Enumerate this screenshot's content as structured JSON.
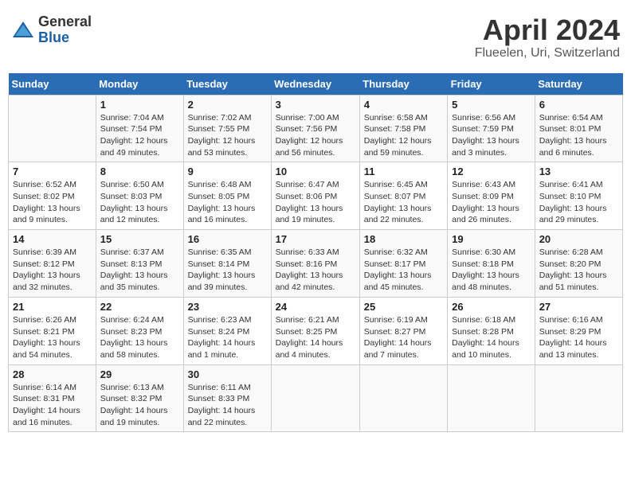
{
  "header": {
    "logo_general": "General",
    "logo_blue": "Blue",
    "month_title": "April 2024",
    "location": "Flueelen, Uri, Switzerland"
  },
  "days_of_week": [
    "Sunday",
    "Monday",
    "Tuesday",
    "Wednesday",
    "Thursday",
    "Friday",
    "Saturday"
  ],
  "weeks": [
    [
      {
        "day": "",
        "info": ""
      },
      {
        "day": "1",
        "info": "Sunrise: 7:04 AM\nSunset: 7:54 PM\nDaylight: 12 hours\nand 49 minutes."
      },
      {
        "day": "2",
        "info": "Sunrise: 7:02 AM\nSunset: 7:55 PM\nDaylight: 12 hours\nand 53 minutes."
      },
      {
        "day": "3",
        "info": "Sunrise: 7:00 AM\nSunset: 7:56 PM\nDaylight: 12 hours\nand 56 minutes."
      },
      {
        "day": "4",
        "info": "Sunrise: 6:58 AM\nSunset: 7:58 PM\nDaylight: 12 hours\nand 59 minutes."
      },
      {
        "day": "5",
        "info": "Sunrise: 6:56 AM\nSunset: 7:59 PM\nDaylight: 13 hours\nand 3 minutes."
      },
      {
        "day": "6",
        "info": "Sunrise: 6:54 AM\nSunset: 8:01 PM\nDaylight: 13 hours\nand 6 minutes."
      }
    ],
    [
      {
        "day": "7",
        "info": "Sunrise: 6:52 AM\nSunset: 8:02 PM\nDaylight: 13 hours\nand 9 minutes."
      },
      {
        "day": "8",
        "info": "Sunrise: 6:50 AM\nSunset: 8:03 PM\nDaylight: 13 hours\nand 12 minutes."
      },
      {
        "day": "9",
        "info": "Sunrise: 6:48 AM\nSunset: 8:05 PM\nDaylight: 13 hours\nand 16 minutes."
      },
      {
        "day": "10",
        "info": "Sunrise: 6:47 AM\nSunset: 8:06 PM\nDaylight: 13 hours\nand 19 minutes."
      },
      {
        "day": "11",
        "info": "Sunrise: 6:45 AM\nSunset: 8:07 PM\nDaylight: 13 hours\nand 22 minutes."
      },
      {
        "day": "12",
        "info": "Sunrise: 6:43 AM\nSunset: 8:09 PM\nDaylight: 13 hours\nand 26 minutes."
      },
      {
        "day": "13",
        "info": "Sunrise: 6:41 AM\nSunset: 8:10 PM\nDaylight: 13 hours\nand 29 minutes."
      }
    ],
    [
      {
        "day": "14",
        "info": "Sunrise: 6:39 AM\nSunset: 8:12 PM\nDaylight: 13 hours\nand 32 minutes."
      },
      {
        "day": "15",
        "info": "Sunrise: 6:37 AM\nSunset: 8:13 PM\nDaylight: 13 hours\nand 35 minutes."
      },
      {
        "day": "16",
        "info": "Sunrise: 6:35 AM\nSunset: 8:14 PM\nDaylight: 13 hours\nand 39 minutes."
      },
      {
        "day": "17",
        "info": "Sunrise: 6:33 AM\nSunset: 8:16 PM\nDaylight: 13 hours\nand 42 minutes."
      },
      {
        "day": "18",
        "info": "Sunrise: 6:32 AM\nSunset: 8:17 PM\nDaylight: 13 hours\nand 45 minutes."
      },
      {
        "day": "19",
        "info": "Sunrise: 6:30 AM\nSunset: 8:18 PM\nDaylight: 13 hours\nand 48 minutes."
      },
      {
        "day": "20",
        "info": "Sunrise: 6:28 AM\nSunset: 8:20 PM\nDaylight: 13 hours\nand 51 minutes."
      }
    ],
    [
      {
        "day": "21",
        "info": "Sunrise: 6:26 AM\nSunset: 8:21 PM\nDaylight: 13 hours\nand 54 minutes."
      },
      {
        "day": "22",
        "info": "Sunrise: 6:24 AM\nSunset: 8:23 PM\nDaylight: 13 hours\nand 58 minutes."
      },
      {
        "day": "23",
        "info": "Sunrise: 6:23 AM\nSunset: 8:24 PM\nDaylight: 14 hours\nand 1 minute."
      },
      {
        "day": "24",
        "info": "Sunrise: 6:21 AM\nSunset: 8:25 PM\nDaylight: 14 hours\nand 4 minutes."
      },
      {
        "day": "25",
        "info": "Sunrise: 6:19 AM\nSunset: 8:27 PM\nDaylight: 14 hours\nand 7 minutes."
      },
      {
        "day": "26",
        "info": "Sunrise: 6:18 AM\nSunset: 8:28 PM\nDaylight: 14 hours\nand 10 minutes."
      },
      {
        "day": "27",
        "info": "Sunrise: 6:16 AM\nSunset: 8:29 PM\nDaylight: 14 hours\nand 13 minutes."
      }
    ],
    [
      {
        "day": "28",
        "info": "Sunrise: 6:14 AM\nSunset: 8:31 PM\nDaylight: 14 hours\nand 16 minutes."
      },
      {
        "day": "29",
        "info": "Sunrise: 6:13 AM\nSunset: 8:32 PM\nDaylight: 14 hours\nand 19 minutes."
      },
      {
        "day": "30",
        "info": "Sunrise: 6:11 AM\nSunset: 8:33 PM\nDaylight: 14 hours\nand 22 minutes."
      },
      {
        "day": "",
        "info": ""
      },
      {
        "day": "",
        "info": ""
      },
      {
        "day": "",
        "info": ""
      },
      {
        "day": "",
        "info": ""
      }
    ]
  ]
}
